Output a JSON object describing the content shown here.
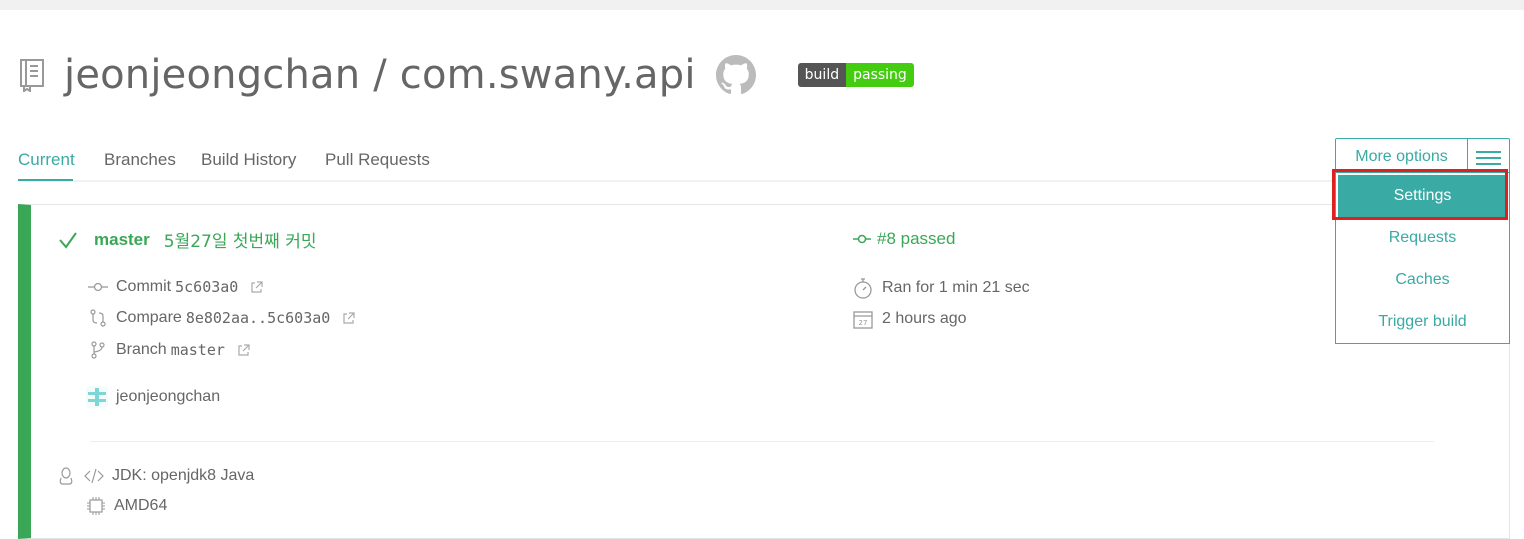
{
  "repo": {
    "title": "jeonjeongchan / com.swany.api",
    "badge_left": "build",
    "badge_right": "passing"
  },
  "tabs": [
    "Current",
    "Branches",
    "Build History",
    "Pull Requests"
  ],
  "more_options": {
    "label": "More options",
    "items": [
      "Settings",
      "Requests",
      "Caches",
      "Trigger build"
    ]
  },
  "build": {
    "branch": "master",
    "commit_message": "5월27일 첫번째 커밋",
    "status": "#8 passed",
    "commit_label": "Commit",
    "commit_hash": "5c603a0",
    "compare_label": "Compare",
    "compare_range": "8e802aa..5c603a0",
    "branch_label": "Branch",
    "branch_value": "master",
    "author": "jeonjeongchan",
    "duration": "Ran for 1 min 21 sec",
    "time_ago": "2 hours ago",
    "jdk": "JDK: openjdk8 Java",
    "arch": "AMD64"
  },
  "colors": {
    "accent": "#39aaa4",
    "passed": "#3aa757",
    "highlight": "#e02020"
  }
}
